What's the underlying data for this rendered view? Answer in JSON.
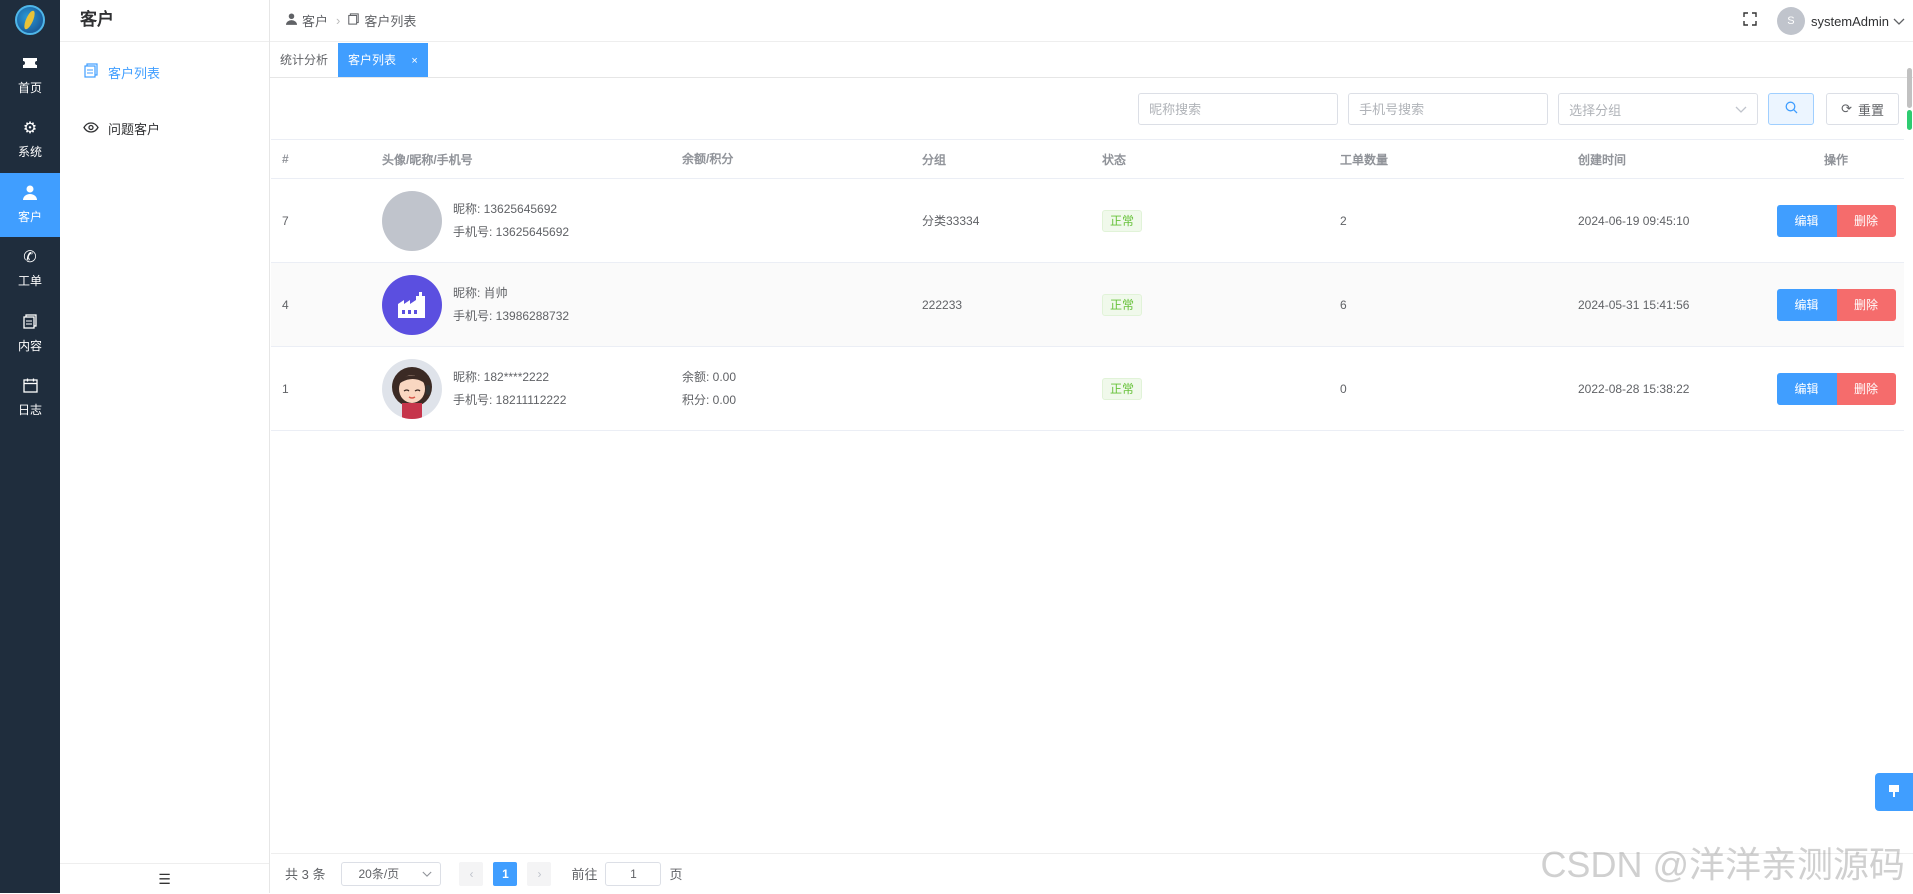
{
  "rail": {
    "items": [
      {
        "label": "首页",
        "icon": "ticket-icon"
      },
      {
        "label": "系统",
        "icon": "gear-icon"
      },
      {
        "label": "客户",
        "icon": "user-icon"
      },
      {
        "label": "工单",
        "icon": "phone-icon"
      },
      {
        "label": "内容",
        "icon": "document-icon"
      },
      {
        "label": "日志",
        "icon": "calendar-icon"
      }
    ]
  },
  "sidebar": {
    "title": "客户",
    "items": [
      {
        "label": "客户列表"
      },
      {
        "label": "问题客户"
      }
    ],
    "collapse_glyph": "☰"
  },
  "header": {
    "breadcrumb": [
      "客户",
      "客户列表"
    ],
    "user_initial": "S",
    "user_name": "systemAdmin"
  },
  "tabs": [
    {
      "label": "统计分析"
    },
    {
      "label": "客户列表",
      "close": "×"
    }
  ],
  "search": {
    "nickname_placeholder": "昵称搜索",
    "phone_placeholder": "手机号搜索",
    "group_placeholder": "选择分组",
    "reset_label": "重置"
  },
  "table": {
    "headers": [
      "#",
      "头像/昵称/手机号",
      "余额/积分",
      "分组",
      "状态",
      "工单数量",
      "创建时间",
      "操作"
    ],
    "rows": [
      {
        "id": "7",
        "nickname": "昵称: 13625645692",
        "phone": "手机号: 13625645692",
        "balance": "",
        "points": "",
        "group": "分类33334",
        "status": "正常",
        "tickets": "2",
        "created": "2024-06-19 09:45:10"
      },
      {
        "id": "4",
        "nickname": "昵称: 肖帅",
        "phone": "手机号: 13986288732",
        "balance": "",
        "points": "",
        "group": "222233",
        "status": "正常",
        "tickets": "6",
        "created": "2024-05-31 15:41:56"
      },
      {
        "id": "1",
        "nickname": "昵称: 182****2222",
        "phone": "手机号: 18211112222",
        "balance": "余额: 0.00",
        "points": "积分: 0.00",
        "group": "",
        "status": "正常",
        "tickets": "0",
        "created": "2022-08-28 15:38:22"
      }
    ],
    "edit_label": "编辑",
    "delete_label": "删除"
  },
  "pager": {
    "total": "共 3 条",
    "page_size": "20条/页",
    "current_page": "1",
    "goto_prefix": "前往",
    "goto_value": "1",
    "goto_suffix": "页"
  },
  "watermark": "CSDN @洋洋亲测源码",
  "colors": {
    "accent": "#409eff",
    "danger": "#f56c6c",
    "success": "#67c23a",
    "rail": "#1f2d3d"
  }
}
